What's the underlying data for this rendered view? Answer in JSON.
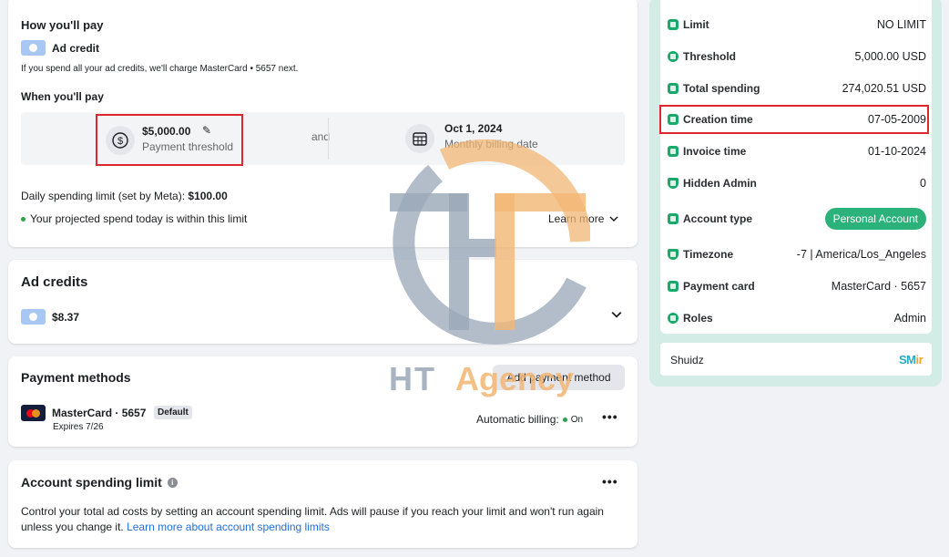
{
  "how_you_pay": {
    "title": "How you'll pay",
    "method_label": "Ad credit",
    "charge_note": "If you spend all your ad credits, we'll charge MasterCard • 5657 next."
  },
  "when_you_pay": {
    "title": "When you'll pay",
    "threshold_value": "$5,000.00",
    "threshold_label": "Payment threshold",
    "and_text": "and",
    "billing_date_value": "Oct 1, 2024",
    "billing_date_label": "Monthly billing date"
  },
  "daily_limit": {
    "label": "Daily spending limit (set by Meta): ",
    "value": "$100.00",
    "projected_text": "Your projected spend today is within this limit",
    "learn_more": "Learn more"
  },
  "ad_credits": {
    "title": "Ad credits",
    "amount": "$8.37"
  },
  "payment_methods": {
    "title": "Payment methods",
    "add_button": "Add payment method",
    "card_name": "MasterCard · 5657",
    "default_badge": "Default",
    "expires": "Expires 7/26",
    "auto_billing_label": "Automatic billing:",
    "auto_billing_state": "On"
  },
  "spending_limit": {
    "title": "Account spending limit",
    "description": "Control your total ad costs by setting an account spending limit. Ads will pause if you reach your limit and won't run again unless you change it. ",
    "link": "Learn more about account spending limits"
  },
  "account_info": {
    "rows": [
      {
        "label": "Limit",
        "value": "NO LIMIT",
        "icon": "card-icon"
      },
      {
        "label": "Threshold",
        "value": "5,000.00 USD",
        "icon": "trend-icon"
      },
      {
        "label": "Total spending",
        "value": "274,020.51 USD",
        "icon": "wallet-icon"
      },
      {
        "label": "Creation time",
        "value": "07-05-2009",
        "icon": "calendar-icon"
      },
      {
        "label": "Invoice time",
        "value": "01-10-2024",
        "icon": "invoice-icon"
      },
      {
        "label": "Hidden Admin",
        "value": "0",
        "icon": "shield-icon"
      },
      {
        "label": "Account type",
        "value": "Personal Account",
        "icon": "person-icon"
      },
      {
        "label": "Timezone",
        "value": "-7 | America/Los_Angeles",
        "icon": "shield-icon"
      },
      {
        "label": "Payment card",
        "value": "MasterCard · 5657",
        "icon": "card-icon"
      },
      {
        "label": "Roles",
        "value": "Admin",
        "icon": "users-icon"
      }
    ],
    "footer_name": "Shuidz",
    "footer_logo_a": "SM",
    "footer_logo_b": "ir"
  },
  "watermark": {
    "word1": "HT",
    "word2": "Agency"
  },
  "colors": {
    "accent_green": "#2bb27a",
    "highlight_red": "#e0262d",
    "link_blue": "#216fdb",
    "panel_mint": "#d3ede6"
  }
}
